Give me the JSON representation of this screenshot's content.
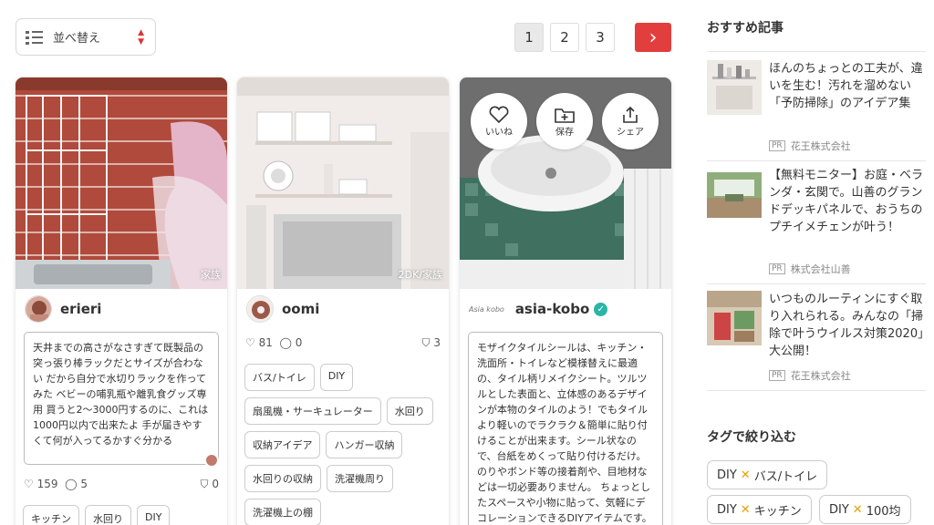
{
  "sort": {
    "label": "並べ替え"
  },
  "pagination": {
    "pages": [
      "1",
      "2",
      "3"
    ],
    "active": "1",
    "next": "›"
  },
  "cards": [
    {
      "room": "家族",
      "username": "erieri",
      "description": "天井までの高さがなさすぎて既製品の突っ張り棒ラックだとサイズが合わない だから自分で水切りラックを作ってみた ベビーの哺乳瓶や離乳食グッズ専用 買うと2〜3000円するのに、これは1000円以内で出来たよ 手が届きやすくて何が入ってるかすぐ分かる",
      "likes": "159",
      "comments": "5",
      "saves": "0",
      "tags": [
        "キッチン",
        "水回り",
        "DIY"
      ]
    },
    {
      "room": "2DK/家族",
      "username": "oomi",
      "likes": "81",
      "comments": "0",
      "saves": "3",
      "tags": [
        "バス/トイレ",
        "DIY",
        "扇風機・サーキュレーター",
        "水回り",
        "収納アイデア",
        "ハンガー収納",
        "水回りの収納",
        "洗濯機周り",
        "洗濯機上の棚"
      ]
    },
    {
      "username": "asia-kobo",
      "logo_text": "Asia kobo",
      "actions": {
        "like": "いいね",
        "save": "保存",
        "share": "シェア"
      },
      "description": "モザイクタイルシールは、キッチン・洗面所・トイレなど模様替えに最適の、タイル柄リメイクシート。ツルツルとした表面と、立体感のあるデザインが本物のタイルのよう！でもタイルより軽いのでラクラク＆簡単に貼り付けることが出来ます。シール状なので、台紙をめくって貼り付けるだけ。 のりやボンド等の接着剤や、目地材などは一切必要ありません。 ちょっとしたスペースや小物に貼って、気軽にデコレーションできるDIYアイテムです。"
    }
  ],
  "sidebar": {
    "recommended_title": "おすすめ記事",
    "articles": [
      {
        "title": "ほんのちょっとの工夫が、違いを生む！汚れを溜めない「予防掃除」のアイデア集",
        "pr": "PR",
        "sponsor": "花王株式会社"
      },
      {
        "title": "【無料モニター】お庭・ベランダ・玄関で。山善のグランドデッキパネルで、おうちのプチイメチェンが叶う！",
        "pr": "PR",
        "sponsor": "株式会社山善"
      },
      {
        "title": "いつものルーティンにすぐ取り入れられる。みんなの「掃除で叶うウイルス対策2020」大公開！",
        "pr": "PR",
        "sponsor": "花王株式会社"
      }
    ],
    "tag_filter_title": "タグで絞り込む",
    "tag_filters": [
      {
        "a": "DIY",
        "b": "バス/トイレ"
      },
      {
        "a": "DIY",
        "b": "キッチン"
      },
      {
        "a": "DIY",
        "b": "100均"
      }
    ]
  },
  "colors": {
    "accent": "#e23e3e",
    "tag_cross": "#e8a000"
  }
}
